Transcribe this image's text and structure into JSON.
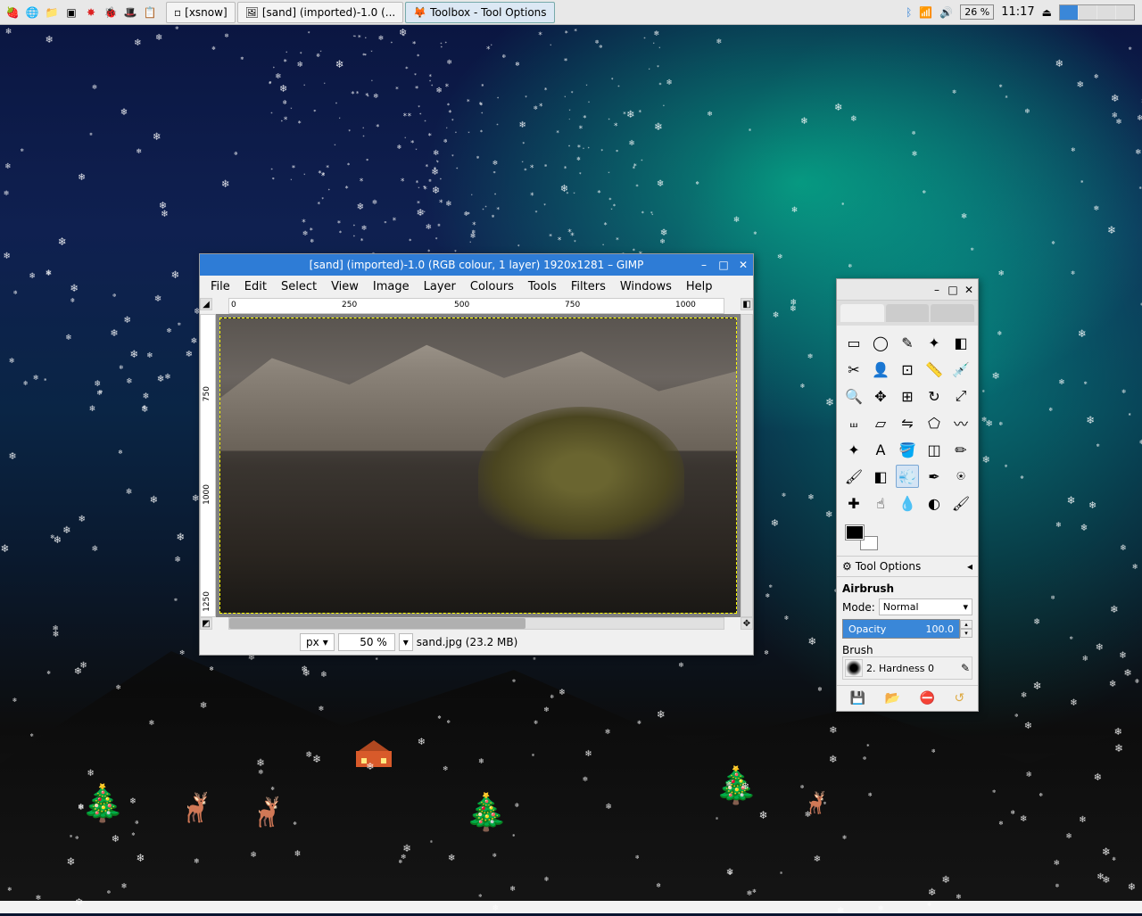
{
  "taskbar": {
    "windows": [
      {
        "label": "[xsnow]"
      },
      {
        "label": "[sand] (imported)-1.0 (..."
      },
      {
        "label": "Toolbox - Tool Options"
      }
    ],
    "battery": "26 %",
    "clock": "11:17"
  },
  "gimp": {
    "title": "[sand] (imported)-1.0 (RGB colour, 1 layer) 1920x1281 – GIMP",
    "menus": [
      "File",
      "Edit",
      "Select",
      "View",
      "Image",
      "Layer",
      "Colours",
      "Tools",
      "Filters",
      "Windows",
      "Help"
    ],
    "ruler_h": [
      "0",
      "250",
      "500",
      "750",
      "1000"
    ],
    "ruler_v": [
      "750",
      "1000",
      "1250"
    ],
    "status": {
      "unit": "px",
      "zoom": "50 %",
      "file": "sand.jpg (23.2 MB)"
    }
  },
  "toolbox": {
    "tools": [
      "rect-select",
      "ellipse-select",
      "free-select",
      "fuzzy-select",
      "by-color-select",
      "scissors",
      "foreground",
      "crop",
      "measure",
      "color-picker",
      "zoom",
      "move",
      "align",
      "rotate",
      "scale",
      "shear",
      "perspective",
      "flip",
      "cage",
      "warp",
      "unified",
      "text",
      "bucket",
      "gradient",
      "pencil",
      "paintbrush",
      "eraser",
      "airbrush",
      "ink",
      "clone",
      "heal",
      "smudge",
      "blur",
      "dodge",
      "mypaint"
    ],
    "selected_tool": "airbrush",
    "opt_header": "Tool Options",
    "opt_tool": "Airbrush",
    "mode_label": "Mode:",
    "mode_value": "Normal",
    "opacity_label": "Opacity",
    "opacity_value": "100.0",
    "brush_label": "Brush",
    "brush_value": "2. Hardness 0"
  },
  "icons": {
    "rect-select": "▭",
    "ellipse-select": "◯",
    "free-select": "✎",
    "fuzzy-select": "✦",
    "by-color-select": "◧",
    "scissors": "✂",
    "foreground": "👤",
    "crop": "⊡",
    "measure": "📏",
    "color-picker": "💉",
    "zoom": "🔍",
    "move": "✥",
    "align": "⊞",
    "rotate": "↻",
    "scale": "⤢",
    "shear": "⧢",
    "perspective": "▱",
    "flip": "⇋",
    "cage": "⬠",
    "warp": "〰",
    "unified": "✦",
    "text": "A",
    "bucket": "🪣",
    "gradient": "◫",
    "pencil": "✏",
    "paintbrush": "🖌",
    "eraser": "◧",
    "airbrush": "💨",
    "ink": "✒",
    "clone": "⍟",
    "heal": "✚",
    "smudge": "☝",
    "blur": "💧",
    "dodge": "◐",
    "mypaint": "🖌"
  }
}
